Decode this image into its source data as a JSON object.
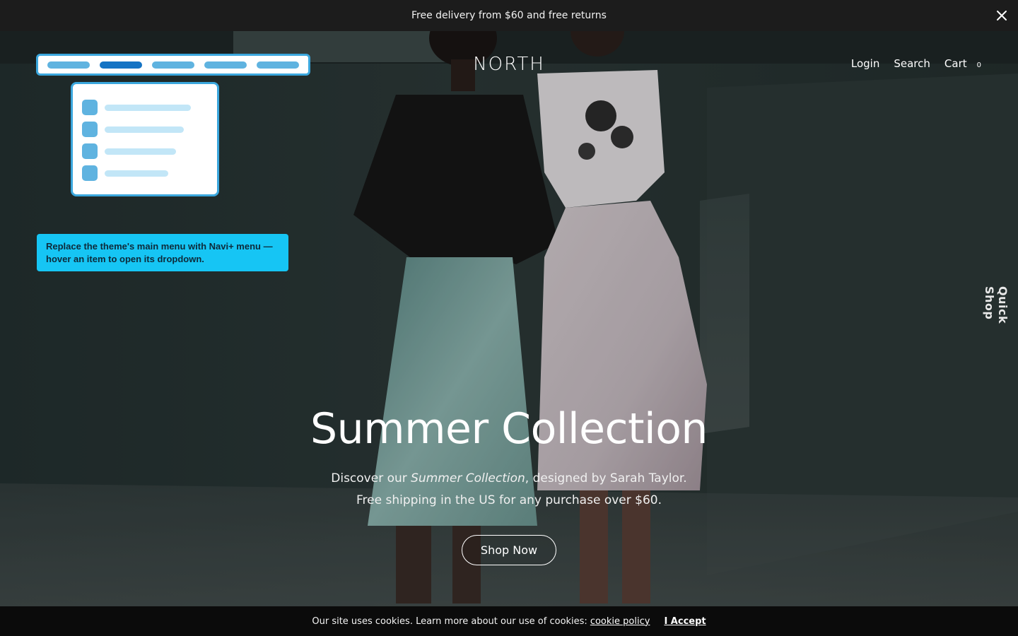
{
  "announcement": {
    "text": "Free delivery from $60 and free returns",
    "close_icon": "close-icon"
  },
  "header": {
    "logo": "NORTH",
    "nav": {
      "login": "Login",
      "search": "Search",
      "cart": "Cart",
      "cart_count": "0"
    }
  },
  "navi_demo": {
    "menu_item_count": 5,
    "active_item_index": 1,
    "dropdown_item_count": 4,
    "tooltip": "Replace the theme's main menu with Navi+ menu — hover an item to open its dropdown.",
    "colors": {
      "border": "#3ba7dd",
      "pill": "#5fb3e0",
      "pill_active": "#1473c4",
      "tooltip_bg": "#16c5f4"
    }
  },
  "side_tab": {
    "label": "Quick Shop"
  },
  "hero": {
    "title": "Summer Collection",
    "subtitle_prefix": "Discover our ",
    "subtitle_em": "Summer Collection",
    "subtitle_suffix": ", designed by Sarah Taylor.",
    "subtitle_line2": "Free shipping in the US for any purchase over $60.",
    "cta": "Shop Now"
  },
  "cookie_bar": {
    "text": "Our site uses cookies. Learn more about our use of cookies: ",
    "policy_link": "cookie policy",
    "accept": "I Accept"
  }
}
